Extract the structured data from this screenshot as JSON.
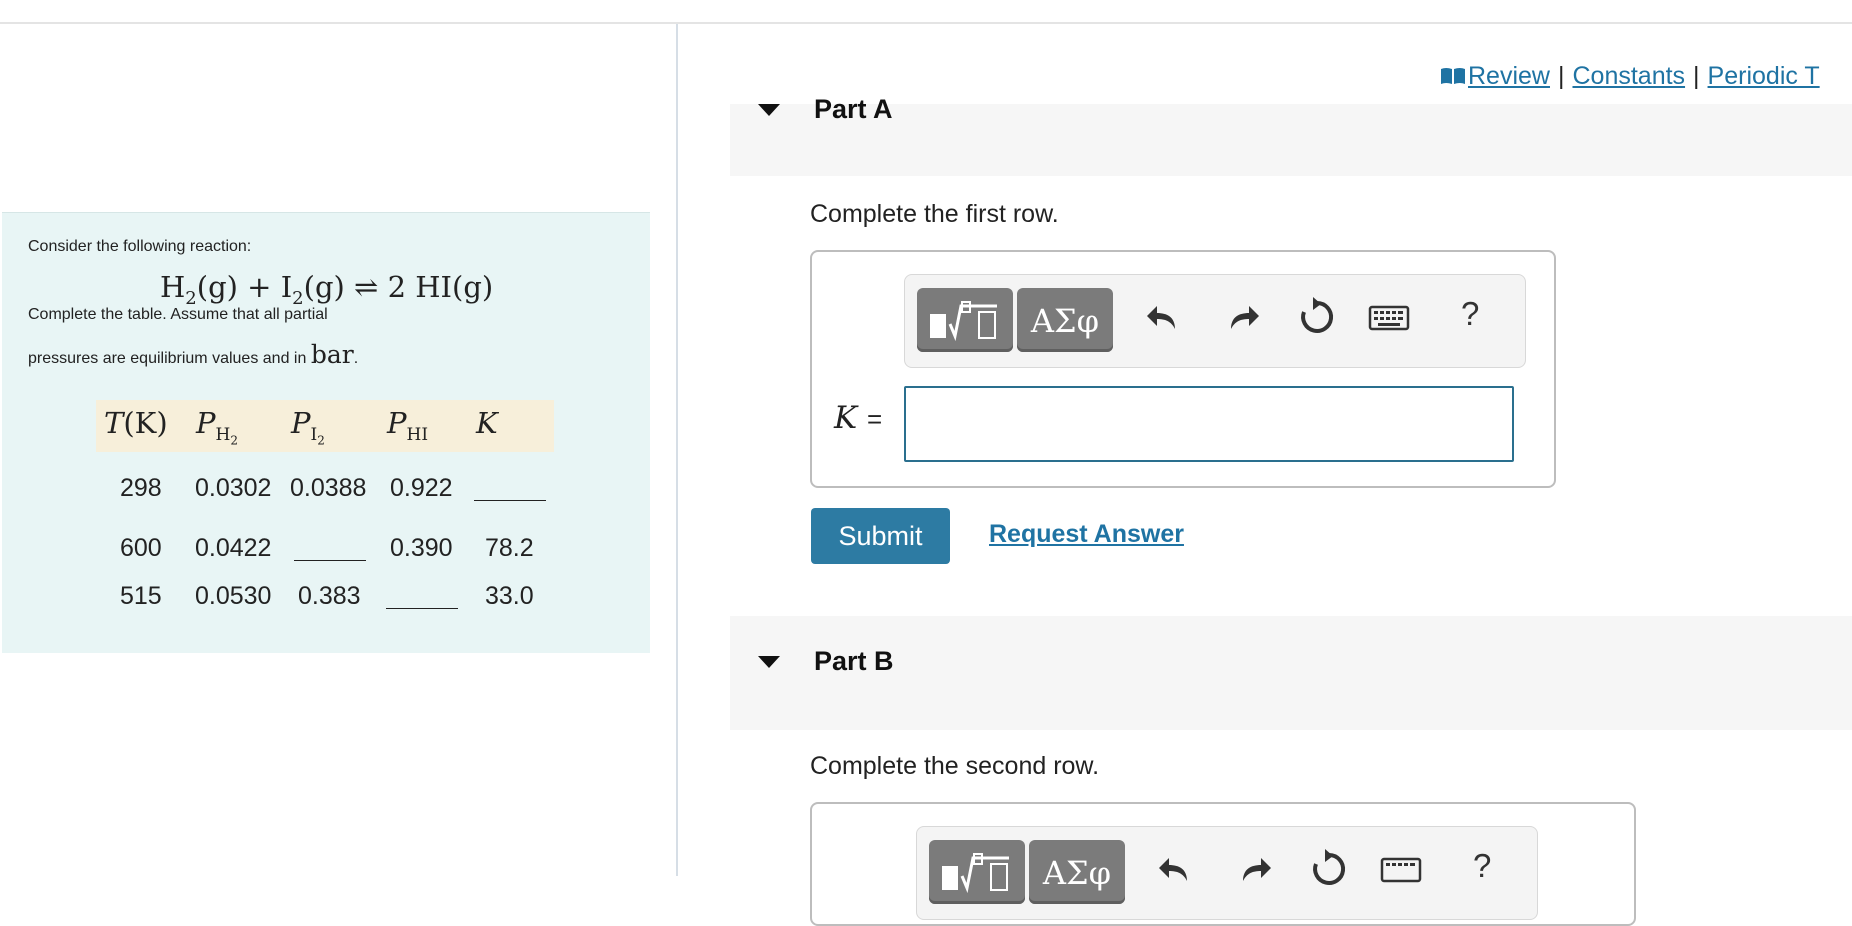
{
  "header_links": {
    "review": "Review",
    "constants": "Constants",
    "periodic": "Periodic T",
    "separator": "|"
  },
  "problem": {
    "intro": "Consider the following reaction:",
    "equation": {
      "reactant1": "H",
      "reactant1_sub": "2",
      "reactant1_state": "(g)",
      "plus": "+",
      "reactant2": "I",
      "reactant2_sub": "2",
      "reactant2_state": "(g)",
      "arrow": "⇌",
      "product": "2 HI",
      "product_state": "(g)"
    },
    "instruction_line1": "Complete the table. Assume that all partial",
    "instruction_line2_pre": "pressures are equilibrium values and in",
    "instruction_unit": "bar",
    "instruction_end": ".",
    "table": {
      "headers": {
        "t": "T",
        "t_unit": "(K)",
        "p_h2": "P",
        "p_h2_sub": "H",
        "p_h2_subsub": "2",
        "p_i2": "P",
        "p_i2_sub": "I",
        "p_i2_subsub": "2",
        "p_hi": "P",
        "p_hi_sub": "HI",
        "k": "K"
      },
      "rows": [
        {
          "t": "298",
          "p_h2": "0.0302",
          "p_i2": "0.0388",
          "p_hi": "0.922",
          "k": ""
        },
        {
          "t": "600",
          "p_h2": "0.0422",
          "p_i2": "",
          "p_hi": "0.390",
          "k": "78.2"
        },
        {
          "t": "515",
          "p_h2": "0.0530",
          "p_i2": "0.383",
          "p_hi": "",
          "k": "33.0"
        }
      ]
    }
  },
  "part_a": {
    "title": "Part A",
    "prompt": "Complete the first row.",
    "k_symbol": "K",
    "equals": "=",
    "input_value": "",
    "toolbar": {
      "greek_label": "ΑΣφ",
      "help_label": "?"
    },
    "submit_label": "Submit",
    "request_answer_label": "Request Answer"
  },
  "part_b": {
    "title": "Part B",
    "prompt": "Complete the second row.",
    "toolbar": {
      "greek_label": "ΑΣφ",
      "help_label": "?"
    }
  },
  "colors": {
    "link": "#1f73a3",
    "submit": "#2d7ba3",
    "input_border": "#2a6f8e",
    "problem_bg": "#e8f5f5",
    "table_header_bg": "#f7efda",
    "toolbar_button": "#7b7b7b"
  }
}
